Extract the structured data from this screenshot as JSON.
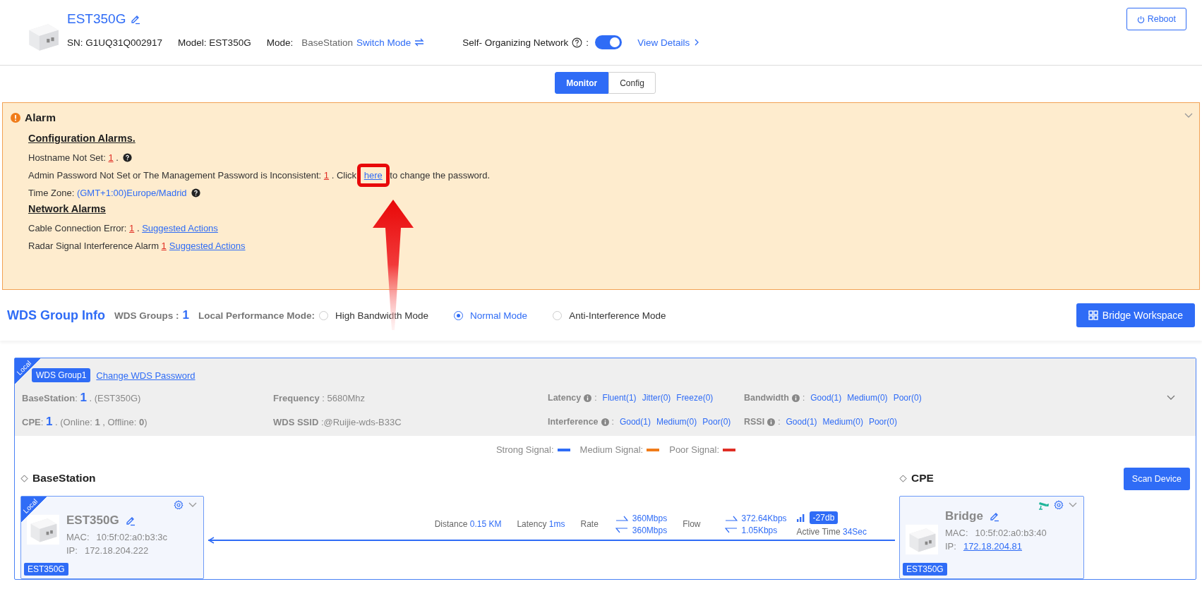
{
  "device": {
    "name": "EST350G",
    "sn": "SN: G1UQ31Q002917",
    "model": "Model: EST350G",
    "mode_label": "Mode:",
    "mode": "BaseStation",
    "switch_link": "Switch Mode",
    "son_label": "Self- Organizing Network",
    "son_colon": ":",
    "son_on": true,
    "details_link": "View Details",
    "reboot": "Reboot"
  },
  "tabs": [
    {
      "label": "Monitor",
      "selected": true
    },
    {
      "label": "Config",
      "selected": false
    }
  ],
  "alarm": {
    "title": "Alarm",
    "sections": [
      {
        "heading": "Configuration Alarms.",
        "rows": [
          {
            "help": true,
            "parts": [
              {
                "kind": "text",
                "text": "Hostname Not Set: "
              },
              {
                "kind": "count",
                "text": "1"
              },
              {
                "kind": "text",
                "text": " ."
              }
            ]
          },
          {
            "help": false,
            "parts": [
              {
                "kind": "text",
                "text": "Admin Password Not Set or The Management Password is Inconsistent: "
              },
              {
                "kind": "count",
                "text": "1"
              },
              {
                "kind": "text",
                "text": " . Click "
              },
              {
                "kind": "link",
                "text": "here",
                "highlighted": true
              },
              {
                "kind": "text",
                "text": " to change the password."
              }
            ]
          },
          {
            "help": true,
            "parts": [
              {
                "kind": "text",
                "text": "Time Zone: "
              },
              {
                "kind": "value",
                "text": "(GMT+1:00)Europe/Madrid"
              }
            ]
          }
        ]
      },
      {
        "heading": "Network Alarms",
        "rows": [
          {
            "help": false,
            "parts": [
              {
                "kind": "text",
                "text": "Cable Connection Error: "
              },
              {
                "kind": "count",
                "text": "1"
              },
              {
                "kind": "text",
                "text": " . "
              },
              {
                "kind": "link",
                "text": "Suggested Actions",
                "highlighted": false
              }
            ]
          },
          {
            "help": false,
            "parts": [
              {
                "kind": "text",
                "text": "Radar Signal Interference Alarm "
              },
              {
                "kind": "count",
                "text": "1"
              },
              {
                "kind": "link",
                "text": "Suggested Actions",
                "highlighted": false
              }
            ]
          }
        ]
      }
    ]
  },
  "annotation_arrow": true,
  "wds": {
    "title": "WDS Group Info",
    "groups_label": "WDS Groups :",
    "groups": "1",
    "mode_label": "Local Performance Mode:",
    "modes": [
      {
        "label": "High Bandwidth Mode",
        "selected": false
      },
      {
        "label": "Normal Mode",
        "selected": true
      },
      {
        "label": "Anti-Interference Mode",
        "selected": false
      }
    ],
    "workspace_button": "Bridge Workspace"
  },
  "group": {
    "ribbon": "Local",
    "tag": "WDS Group1",
    "password_link": "Change WDS Password",
    "stats": [
      {
        "kind": "count",
        "label": "BaseStation",
        "colon": ":",
        "count": "1",
        "rest": " . (EST350G)"
      },
      {
        "kind": "plain",
        "label": "Frequency",
        "value": " : 5680Mhz"
      },
      {
        "kind": "levels",
        "label": "Latency",
        "colon": ":",
        "values": [
          "Fluent(1)",
          "Jitter(0)",
          "Freeze(0)"
        ]
      },
      {
        "kind": "levels",
        "label": "Bandwidth",
        "colon": ":",
        "values": [
          "Good(1)",
          "Medium(0)",
          "Poor(0)"
        ]
      },
      {
        "kind": "count",
        "label": "CPE",
        "colon": ":",
        "count": "1",
        "rest": " . (Online: **1** , Offline: **0**)"
      },
      {
        "kind": "plain",
        "label": "WDS SSID",
        "value": " :@Ruijie-wds-B33C"
      },
      {
        "kind": "levels",
        "label": "Interference",
        "colon": ":",
        "values": [
          "Good(1)",
          "Medium(0)",
          "Poor(0)"
        ]
      },
      {
        "kind": "levels",
        "label": "RSSI",
        "colon": ":",
        "values": [
          "Good(1)",
          "Medium(0)",
          "Poor(0)"
        ]
      }
    ],
    "legend": [
      {
        "label": "Strong Signal:",
        "color": "#2f6cf6"
      },
      {
        "label": "Medium Signal:",
        "color": "#f07c1a"
      },
      {
        "label": "Poor Signal:",
        "color": "#e02e24"
      }
    ],
    "base_heading": "BaseStation",
    "cpe_heading": "CPE",
    "scan_button": "Scan Device",
    "devices": [
      {
        "kind": "base",
        "ribbon": "Local",
        "name": "EST350G",
        "mac_label": "MAC:",
        "mac": "10:5f:02:a0:b3:3c",
        "ip_label": "IP:",
        "ip": "172.18.204.222",
        "model": "EST350G"
      },
      {
        "kind": "cpe",
        "name": "Bridge",
        "mac_label": "MAC:",
        "mac": "10:5f:02:a0:b3:40",
        "ip_label": "IP:",
        "ip": "172.18.204.81",
        "model": "EST350G"
      }
    ],
    "link": {
      "distance_label": "Distance",
      "distance": "0.15 KM",
      "latency_label": "Latency",
      "latency": "1ms",
      "rate_label": "Rate",
      "rate_up": "360Mbps",
      "rate_down": "360Mbps",
      "flow_label": "Flow",
      "flow_up": "372.64Kbps",
      "flow_down": "1.05Kbps",
      "signal": "-27db",
      "active_label": "Active Time",
      "active": "34Sec"
    }
  }
}
